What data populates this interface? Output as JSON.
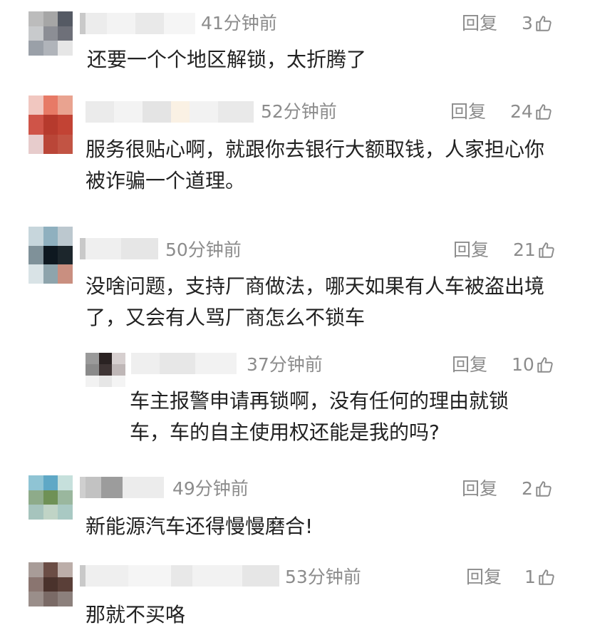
{
  "comments": [
    {
      "time": "41分钟前",
      "reply": "回复",
      "likes": "3",
      "text": "还要一个个地区解锁，太折腾了"
    },
    {
      "time": "52分钟前",
      "reply": "回复",
      "likes": "24",
      "text": "服务很贴心啊，就跟你去银行大额取钱，人家担心你被诈骗一个道理。"
    },
    {
      "time": "50分钟前",
      "reply": "回复",
      "likes": "21",
      "text": "没啥问题，支持厂商做法，哪天如果有人车被盗出境了，又会有人骂厂商怎么不锁车"
    },
    {
      "time": "37分钟前",
      "reply": "回复",
      "likes": "10",
      "text": "车主报警申请再锁啊，没有任何的理由就锁车，车的自主使用权还能是我的吗?"
    },
    {
      "time": "49分钟前",
      "reply": "回复",
      "likes": "2",
      "text": "新能源汽车还得慢慢磨合!"
    },
    {
      "time": "53分钟前",
      "reply": "回复",
      "likes": "1",
      "text": "那就不买咯"
    }
  ],
  "colors": {
    "meta": "#8c8c8c",
    "text": "#222222",
    "background": "#ffffff"
  },
  "icons": {
    "like": "thumbs-up-icon",
    "avatar": "pixelated-avatar",
    "username": "blurred-username"
  }
}
